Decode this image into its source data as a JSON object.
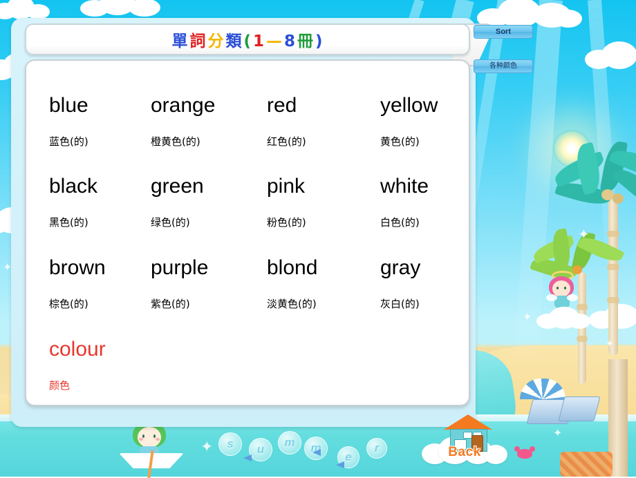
{
  "title": {
    "full": "單詞分類(1—8冊)",
    "chars": [
      {
        "ch": "單",
        "color": "#2b4fd6"
      },
      {
        "ch": "詞",
        "color": "#e02020"
      },
      {
        "ch": "分",
        "color": "#f2b705"
      },
      {
        "ch": "類",
        "color": "#2b4fd6"
      },
      {
        "ch": "(",
        "color": "#1f9d3a"
      },
      {
        "ch": "1",
        "color": "#e02020"
      },
      {
        "ch": "—",
        "color": "#f2b705"
      },
      {
        "ch": "8",
        "color": "#2b4fd6"
      },
      {
        "ch": "冊",
        "color": "#1f9d3a"
      },
      {
        "ch": ")",
        "color": "#2b4fd6"
      }
    ]
  },
  "toolbar": {
    "sort_label": "Sort",
    "category_label": "各种颜色"
  },
  "words": [
    {
      "en": "blue",
      "cn": "蓝色(的)",
      "color": "#000000"
    },
    {
      "en": "orange",
      "cn": "橙黄色(的)",
      "color": "#000000"
    },
    {
      "en": "red",
      "cn": "红色(的)",
      "color": "#000000"
    },
    {
      "en": "yellow",
      "cn": "黄色(的)",
      "color": "#000000"
    },
    {
      "en": "black",
      "cn": "黑色(的)",
      "color": "#000000"
    },
    {
      "en": "green",
      "cn": "绿色(的)",
      "color": "#000000"
    },
    {
      "en": "pink",
      "cn": "粉色(的)",
      "color": "#000000"
    },
    {
      "en": "white",
      "cn": "白色(的)",
      "color": "#000000"
    },
    {
      "en": "brown",
      "cn": "棕色(的)",
      "color": "#000000"
    },
    {
      "en": "purple",
      "cn": "紫色(的)",
      "color": "#000000"
    },
    {
      "en": "blond",
      "cn": "淡黄色(的)",
      "color": "#000000"
    },
    {
      "en": "gray",
      "cn": "灰白(的)",
      "color": "#000000"
    },
    {
      "en": "colour",
      "cn": "颜色",
      "color": "#e8362c"
    }
  ],
  "back_button": {
    "label": "Back",
    "icon": "house-on-cloud-icon"
  },
  "background": {
    "bubble_letters": [
      "s",
      "u",
      "m",
      "m",
      "e",
      "r"
    ],
    "scene": "tropical-beach"
  },
  "colors": {
    "sky": "#35cdf4",
    "sea": "#63dddе",
    "sand": "#f7dc94",
    "panel": "#cdeff9",
    "accent_red": "#e8362c",
    "accent_orange": "#f47a20"
  }
}
